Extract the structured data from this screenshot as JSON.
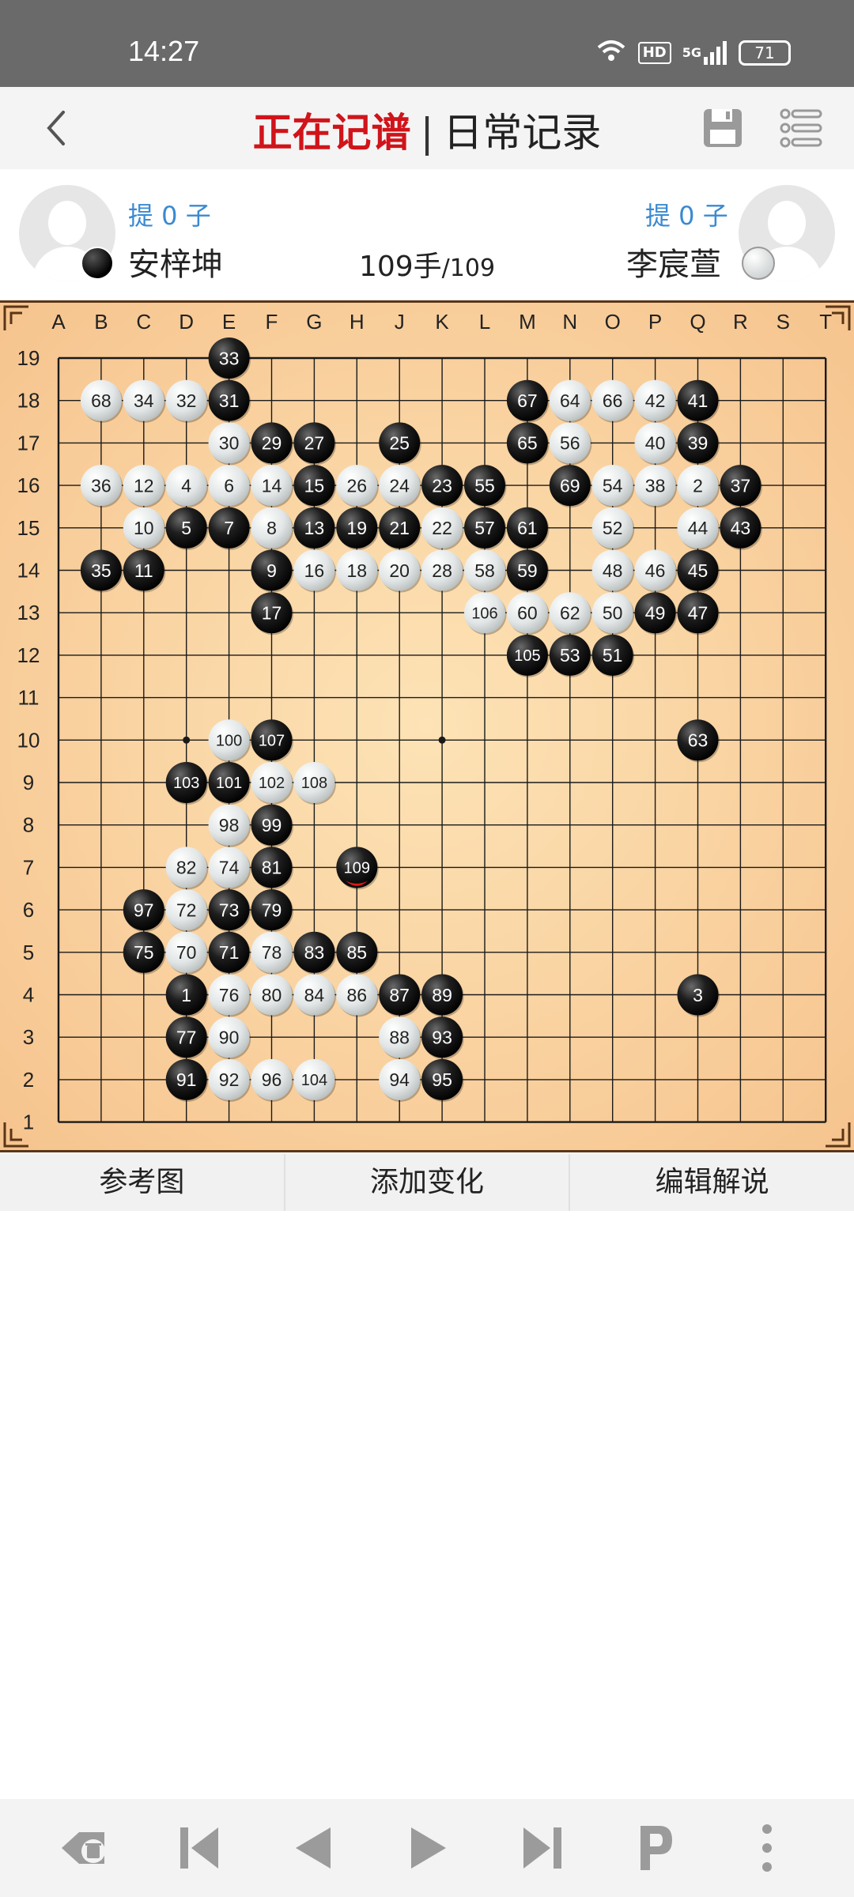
{
  "status_bar": {
    "time": "14:27",
    "hd_label": "HD",
    "network_label": "5G",
    "battery": "71"
  },
  "header": {
    "title_active": "正在记谱",
    "separator": "|",
    "title_record": "日常记录",
    "back_icon": "chevron-left-icon",
    "save_icon": "save-icon",
    "menu_icon": "list-menu-icon"
  },
  "players": {
    "black": {
      "name": "安梓坤",
      "captures": "提 0 子",
      "stone": "black"
    },
    "white": {
      "name": "李宸萱",
      "captures": "提 0 子",
      "stone": "white"
    },
    "move_count": "109手",
    "move_total": "/109"
  },
  "board": {
    "columns": [
      "A",
      "B",
      "C",
      "D",
      "E",
      "F",
      "G",
      "H",
      "J",
      "K",
      "L",
      "M",
      "N",
      "O",
      "P",
      "Q",
      "R",
      "S",
      "T"
    ],
    "rows": [
      "19",
      "18",
      "17",
      "16",
      "15",
      "14",
      "13",
      "12",
      "11",
      "10",
      "9",
      "8",
      "7",
      "6",
      "5",
      "4",
      "3",
      "2",
      "1"
    ],
    "colors": {
      "wood": "#f6c48e",
      "line": "#1a1a1a",
      "last_move_marker": "#e0171a"
    },
    "last_move": 109,
    "stones": [
      {
        "n": 1,
        "col": "D",
        "row": 4,
        "c": "b"
      },
      {
        "n": 3,
        "col": "Q",
        "row": 4,
        "c": "b"
      },
      {
        "n": 5,
        "col": "D",
        "row": 15,
        "c": "b"
      },
      {
        "n": 7,
        "col": "E",
        "row": 15,
        "c": "b"
      },
      {
        "n": 9,
        "col": "F",
        "row": 14,
        "c": "b"
      },
      {
        "n": 11,
        "col": "C",
        "row": 14,
        "c": "b"
      },
      {
        "n": 13,
        "col": "G",
        "row": 15,
        "c": "b"
      },
      {
        "n": 15,
        "col": "G",
        "row": 16,
        "c": "b"
      },
      {
        "n": 17,
        "col": "F",
        "row": 13,
        "c": "b"
      },
      {
        "n": 19,
        "col": "H",
        "row": 15,
        "c": "b"
      },
      {
        "n": 21,
        "col": "J",
        "row": 15,
        "c": "b"
      },
      {
        "n": 23,
        "col": "K",
        "row": 16,
        "c": "b"
      },
      {
        "n": 25,
        "col": "J",
        "row": 17,
        "c": "b"
      },
      {
        "n": 27,
        "col": "G",
        "row": 17,
        "c": "b"
      },
      {
        "n": 29,
        "col": "F",
        "row": 17,
        "c": "b"
      },
      {
        "n": 31,
        "col": "E",
        "row": 18,
        "c": "b"
      },
      {
        "n": 33,
        "col": "E",
        "row": 19,
        "c": "b"
      },
      {
        "n": 35,
        "col": "B",
        "row": 14,
        "c": "b"
      },
      {
        "n": 37,
        "col": "R",
        "row": 16,
        "c": "b"
      },
      {
        "n": 39,
        "col": "Q",
        "row": 17,
        "c": "b"
      },
      {
        "n": 41,
        "col": "Q",
        "row": 18,
        "c": "b"
      },
      {
        "n": 43,
        "col": "R",
        "row": 15,
        "c": "b"
      },
      {
        "n": 45,
        "col": "Q",
        "row": 14,
        "c": "b"
      },
      {
        "n": 47,
        "col": "Q",
        "row": 13,
        "c": "b"
      },
      {
        "n": 49,
        "col": "P",
        "row": 13,
        "c": "b"
      },
      {
        "n": 51,
        "col": "O",
        "row": 12,
        "c": "b"
      },
      {
        "n": 53,
        "col": "N",
        "row": 12,
        "c": "b"
      },
      {
        "n": 55,
        "col": "L",
        "row": 16,
        "c": "b"
      },
      {
        "n": 57,
        "col": "L",
        "row": 15,
        "c": "b"
      },
      {
        "n": 59,
        "col": "M",
        "row": 14,
        "c": "b"
      },
      {
        "n": 61,
        "col": "M",
        "row": 15,
        "c": "b"
      },
      {
        "n": 63,
        "col": "Q",
        "row": 10,
        "c": "b"
      },
      {
        "n": 65,
        "col": "M",
        "row": 17,
        "c": "b"
      },
      {
        "n": 67,
        "col": "M",
        "row": 18,
        "c": "b"
      },
      {
        "n": 69,
        "col": "N",
        "row": 16,
        "c": "b"
      },
      {
        "n": 71,
        "col": "E",
        "row": 5,
        "c": "b"
      },
      {
        "n": 73,
        "col": "E",
        "row": 6,
        "c": "b"
      },
      {
        "n": 75,
        "col": "C",
        "row": 5,
        "c": "b"
      },
      {
        "n": 77,
        "col": "D",
        "row": 3,
        "c": "b"
      },
      {
        "n": 79,
        "col": "F",
        "row": 6,
        "c": "b"
      },
      {
        "n": 81,
        "col": "F",
        "row": 7,
        "c": "b"
      },
      {
        "n": 83,
        "col": "G",
        "row": 5,
        "c": "b"
      },
      {
        "n": 85,
        "col": "H",
        "row": 5,
        "c": "b"
      },
      {
        "n": 87,
        "col": "J",
        "row": 4,
        "c": "b"
      },
      {
        "n": 89,
        "col": "K",
        "row": 4,
        "c": "b"
      },
      {
        "n": 91,
        "col": "D",
        "row": 2,
        "c": "b"
      },
      {
        "n": 93,
        "col": "K",
        "row": 3,
        "c": "b"
      },
      {
        "n": 95,
        "col": "K",
        "row": 2,
        "c": "b"
      },
      {
        "n": 97,
        "col": "C",
        "row": 6,
        "c": "b"
      },
      {
        "n": 99,
        "col": "F",
        "row": 8,
        "c": "b"
      },
      {
        "n": 101,
        "col": "E",
        "row": 9,
        "c": "b"
      },
      {
        "n": 103,
        "col": "D",
        "row": 9,
        "c": "b"
      },
      {
        "n": 105,
        "col": "M",
        "row": 12,
        "c": "b"
      },
      {
        "n": 107,
        "col": "F",
        "row": 10,
        "c": "b"
      },
      {
        "n": 109,
        "col": "H",
        "row": 7,
        "c": "b"
      },
      {
        "n": 2,
        "col": "Q",
        "row": 16,
        "c": "w"
      },
      {
        "n": 4,
        "col": "D",
        "row": 16,
        "c": "w"
      },
      {
        "n": 6,
        "col": "E",
        "row": 16,
        "c": "w"
      },
      {
        "n": 8,
        "col": "F",
        "row": 15,
        "c": "w"
      },
      {
        "n": 10,
        "col": "C",
        "row": 15,
        "c": "w"
      },
      {
        "n": 12,
        "col": "C",
        "row": 16,
        "c": "w"
      },
      {
        "n": 14,
        "col": "F",
        "row": 16,
        "c": "w"
      },
      {
        "n": 16,
        "col": "G",
        "row": 14,
        "c": "w"
      },
      {
        "n": 18,
        "col": "H",
        "row": 14,
        "c": "w"
      },
      {
        "n": 20,
        "col": "J",
        "row": 14,
        "c": "w"
      },
      {
        "n": 22,
        "col": "K",
        "row": 15,
        "c": "w"
      },
      {
        "n": 24,
        "col": "J",
        "row": 16,
        "c": "w"
      },
      {
        "n": 26,
        "col": "H",
        "row": 16,
        "c": "w"
      },
      {
        "n": 28,
        "col": "K",
        "row": 14,
        "c": "w"
      },
      {
        "n": 30,
        "col": "E",
        "row": 17,
        "c": "w"
      },
      {
        "n": 32,
        "col": "D",
        "row": 18,
        "c": "w"
      },
      {
        "n": 34,
        "col": "C",
        "row": 18,
        "c": "w"
      },
      {
        "n": 36,
        "col": "B",
        "row": 16,
        "c": "w"
      },
      {
        "n": 38,
        "col": "P",
        "row": 16,
        "c": "w"
      },
      {
        "n": 40,
        "col": "P",
        "row": 17,
        "c": "w"
      },
      {
        "n": 42,
        "col": "P",
        "row": 18,
        "c": "w"
      },
      {
        "n": 44,
        "col": "Q",
        "row": 15,
        "c": "w"
      },
      {
        "n": 46,
        "col": "P",
        "row": 14,
        "c": "w"
      },
      {
        "n": 48,
        "col": "O",
        "row": 14,
        "c": "w"
      },
      {
        "n": 50,
        "col": "O",
        "row": 13,
        "c": "w"
      },
      {
        "n": 52,
        "col": "O",
        "row": 15,
        "c": "w"
      },
      {
        "n": 54,
        "col": "O",
        "row": 16,
        "c": "w"
      },
      {
        "n": 56,
        "col": "N",
        "row": 17,
        "c": "w"
      },
      {
        "n": 58,
        "col": "L",
        "row": 14,
        "c": "w"
      },
      {
        "n": 60,
        "col": "M",
        "row": 13,
        "c": "w"
      },
      {
        "n": 62,
        "col": "N",
        "row": 13,
        "c": "w"
      },
      {
        "n": 64,
        "col": "N",
        "row": 18,
        "c": "w"
      },
      {
        "n": 66,
        "col": "O",
        "row": 18,
        "c": "w"
      },
      {
        "n": 68,
        "col": "B",
        "row": 18,
        "c": "w"
      },
      {
        "n": 70,
        "col": "D",
        "row": 5,
        "c": "w"
      },
      {
        "n": 72,
        "col": "D",
        "row": 6,
        "c": "w"
      },
      {
        "n": 74,
        "col": "E",
        "row": 7,
        "c": "w"
      },
      {
        "n": 76,
        "col": "E",
        "row": 4,
        "c": "w"
      },
      {
        "n": 78,
        "col": "F",
        "row": 5,
        "c": "w"
      },
      {
        "n": 80,
        "col": "F",
        "row": 4,
        "c": "w"
      },
      {
        "n": 82,
        "col": "D",
        "row": 7,
        "c": "w"
      },
      {
        "n": 84,
        "col": "G",
        "row": 4,
        "c": "w"
      },
      {
        "n": 86,
        "col": "H",
        "row": 4,
        "c": "w"
      },
      {
        "n": 88,
        "col": "J",
        "row": 3,
        "c": "w"
      },
      {
        "n": 90,
        "col": "E",
        "row": 3,
        "c": "w"
      },
      {
        "n": 92,
        "col": "E",
        "row": 2,
        "c": "w"
      },
      {
        "n": 94,
        "col": "J",
        "row": 2,
        "c": "w"
      },
      {
        "n": 96,
        "col": "F",
        "row": 2,
        "c": "w"
      },
      {
        "n": 98,
        "col": "E",
        "row": 8,
        "c": "w"
      },
      {
        "n": 100,
        "col": "E",
        "row": 10,
        "c": "w"
      },
      {
        "n": 102,
        "col": "F",
        "row": 9,
        "c": "w"
      },
      {
        "n": 104,
        "col": "G",
        "row": 2,
        "c": "w"
      },
      {
        "n": 106,
        "col": "L",
        "row": 13,
        "c": "w"
      },
      {
        "n": 108,
        "col": "G",
        "row": 9,
        "c": "w"
      }
    ]
  },
  "toolbar": {
    "reference": "参考图",
    "add_variation": "添加变化",
    "edit_comment": "编辑解说"
  },
  "bottom_bar": {
    "icons": [
      "delete-move-icon",
      "first-move-icon",
      "prev-move-icon",
      "next-move-icon",
      "last-move-icon",
      "pass-icon",
      "more-icon"
    ]
  }
}
